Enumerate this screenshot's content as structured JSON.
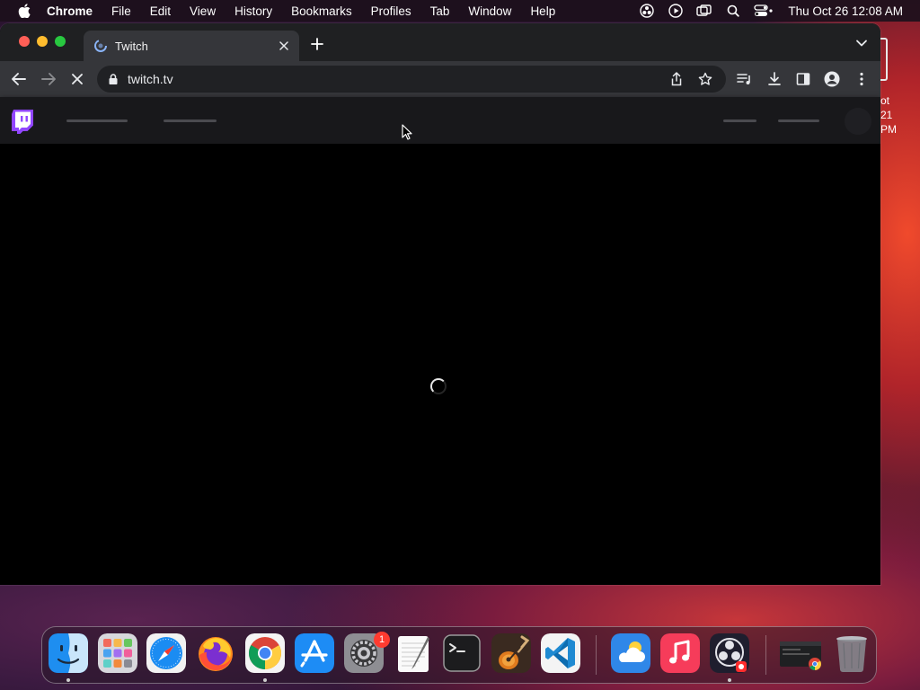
{
  "menubar": {
    "items": [
      "Chrome",
      "File",
      "Edit",
      "View",
      "History",
      "Bookmarks",
      "Profiles",
      "Tab",
      "Window",
      "Help"
    ],
    "clock": "Thu Oct 26  12:08 AM"
  },
  "desktop": {
    "peek_line1": "ot",
    "peek_line2": "21 PM"
  },
  "browser": {
    "tab_title": "Twitch",
    "url": "twitch.tv"
  },
  "page": {
    "brand_color": "#9146ff",
    "loading": true
  },
  "dock": {
    "apps": [
      "Finder",
      "Launchpad",
      "Safari",
      "Firefox",
      "Google Chrome",
      "App Store",
      "System Settings",
      "TextEdit",
      "Terminal",
      "GarageBand",
      "Visual Studio Code",
      "Weather",
      "Music",
      "OBS",
      "Chrome window",
      "Trash"
    ],
    "settings_badge": "1"
  },
  "colors": {
    "tabstrip": "#1f2022",
    "toolbar": "#35363a",
    "omnibox": "#202124",
    "twitch_nav": "#18181b"
  }
}
